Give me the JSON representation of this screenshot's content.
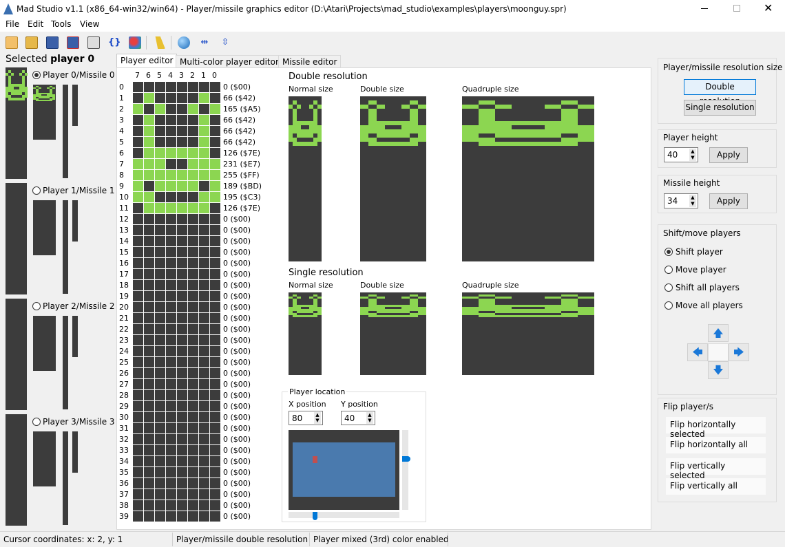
{
  "window": {
    "title": "Mad Studio  v1.1 (x86_64-win32/win64) - Player/missile graphics editor (D:\\Atari\\Projects\\mad_studio\\examples\\players\\moonguy.spr)"
  },
  "menu": [
    "File",
    "Edit",
    "Tools",
    "View"
  ],
  "toolbar_icons": [
    "open-icon",
    "package-icon",
    "save-icon",
    "save-as-icon",
    "export-icon",
    "code-icon",
    "palette-icon",
    "clear-icon",
    "ball-icon",
    "fit-horizontal-icon",
    "fit-vertical-icon"
  ],
  "left": {
    "selected_prefix": "Selected",
    "selected_player": "player 0",
    "players": [
      "Player 0/Missile 0",
      "Player 1/Missile 1",
      "Player 2/Missile 2",
      "Player 3/Missile 3"
    ],
    "selected_index": 0
  },
  "tabs": [
    "Player editor",
    "Multi-color player editor",
    "Missile editor"
  ],
  "editor": {
    "bit_headers": [
      "7",
      "6",
      "5",
      "4",
      "3",
      "2",
      "1",
      "0"
    ],
    "rows": [
      0,
      66,
      165,
      66,
      66,
      66,
      126,
      231,
      255,
      189,
      195,
      126,
      0,
      0,
      0,
      0,
      0,
      0,
      0,
      0,
      0,
      0,
      0,
      0,
      0,
      0,
      0,
      0,
      0,
      0,
      0,
      0,
      0,
      0,
      0,
      0,
      0,
      0,
      0,
      0
    ],
    "value_labels": [
      "0 ($00)",
      "66 ($42)",
      "165 ($A5)",
      "66 ($42)",
      "66 ($42)",
      "66 ($42)",
      "126 ($7E)",
      "231 ($E7)",
      "255 ($FF)",
      "189 ($BD)",
      "195 ($C3)",
      "126 ($7E)",
      "0 ($00)",
      "0 ($00)",
      "0 ($00)",
      "0 ($00)",
      "0 ($00)",
      "0 ($00)",
      "0 ($00)",
      "0 ($00)",
      "0 ($00)",
      "0 ($00)",
      "0 ($00)",
      "0 ($00)",
      "0 ($00)",
      "0 ($00)",
      "0 ($00)",
      "0 ($00)",
      "0 ($00)",
      "0 ($00)",
      "0 ($00)",
      "0 ($00)",
      "0 ($00)",
      "0 ($00)",
      "0 ($00)",
      "0 ($00)",
      "0 ($00)",
      "0 ($00)",
      "0 ($00)",
      "0 ($00)"
    ]
  },
  "preview": {
    "double_title": "Double resolution",
    "single_title": "Single resolution",
    "normal": "Normal size",
    "double": "Double size",
    "quadruple": "Quadruple size"
  },
  "location": {
    "title": "Player location",
    "x_label": "X position",
    "y_label": "Y position",
    "x_value": "80",
    "y_value": "40"
  },
  "right": {
    "res_title": "Player/missile resolution size",
    "double_btn": "Double resolution",
    "single_btn": "Single resolution",
    "height_title": "Player height",
    "height_value": "40",
    "missile_title": "Missile height",
    "missile_value": "34",
    "apply": "Apply",
    "shift_title": "Shift/move players",
    "shift_opts": [
      "Shift player",
      "Move player",
      "Shift all players",
      "Move all players"
    ],
    "shift_selected": 0,
    "flip_title": "Flip player/s",
    "flip_opts": [
      "Flip horizontally selected",
      "Flip horizontally all",
      "Flip vertically selected",
      "Flip vertically all"
    ]
  },
  "status": [
    "Cursor coordinates: x: 2, y: 1",
    "Player/missile double resolution",
    "Player mixed (3rd) color enabled"
  ],
  "colors": {
    "on": "#8cd651",
    "off": "#3c3c3c",
    "screen": "#4a7aae",
    "marker": "#c05050",
    "accent": "#0078d7"
  }
}
